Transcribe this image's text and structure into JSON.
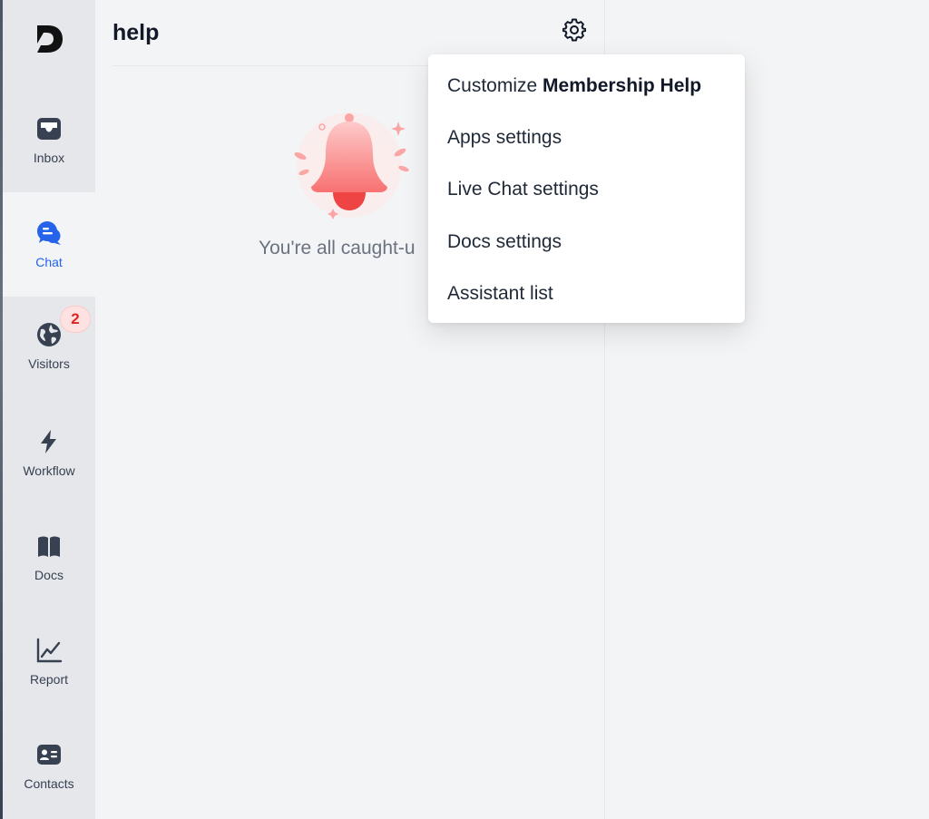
{
  "sidebar": {
    "items": [
      {
        "label": "Inbox",
        "icon": "inbox-icon"
      },
      {
        "label": "Chat",
        "icon": "chat-icon",
        "active": true
      },
      {
        "label": "Visitors",
        "icon": "globe-icon",
        "badge": "2"
      },
      {
        "label": "Workflow",
        "icon": "lightning-icon"
      },
      {
        "label": "Docs",
        "icon": "book-icon"
      },
      {
        "label": "Report",
        "icon": "chart-line-icon"
      },
      {
        "label": "Contacts",
        "icon": "contact-card-icon"
      }
    ]
  },
  "panel": {
    "title": "help",
    "empty_message": "You're all caught-u"
  },
  "menu": {
    "customize_prefix": "Customize ",
    "customize_name": "Membership Help",
    "items": [
      "Apps settings",
      "Live Chat settings",
      "Docs settings",
      "Assistant list"
    ]
  },
  "colors": {
    "accent": "#2563eb",
    "badge_text": "#dc2626",
    "badge_bg": "#fee2e2",
    "sidebar_bg": "#e5e7eb",
    "icon": "#374151"
  }
}
